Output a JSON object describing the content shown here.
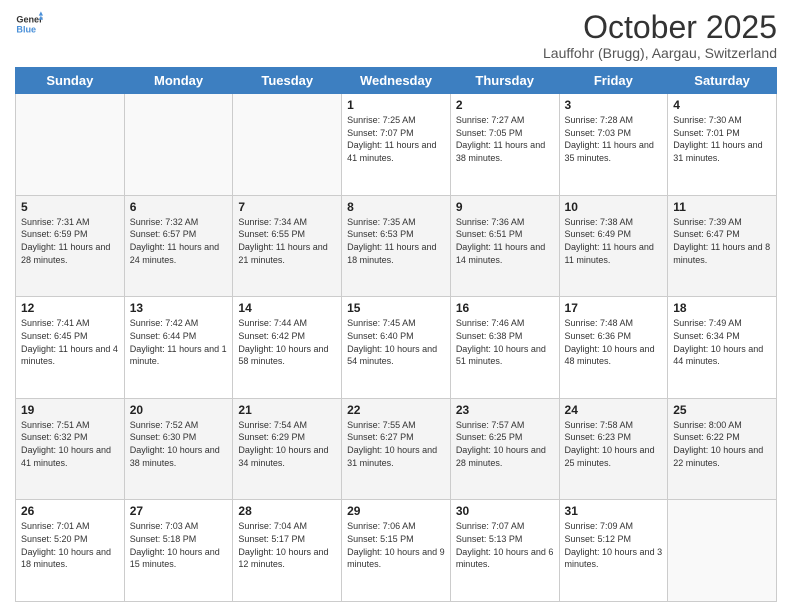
{
  "header": {
    "logo_line1": "General",
    "logo_line2": "Blue",
    "month_title": "October 2025",
    "location": "Lauffohr (Brugg), Aargau, Switzerland"
  },
  "weekdays": [
    "Sunday",
    "Monday",
    "Tuesday",
    "Wednesday",
    "Thursday",
    "Friday",
    "Saturday"
  ],
  "weeks": [
    [
      {
        "day": "",
        "info": ""
      },
      {
        "day": "",
        "info": ""
      },
      {
        "day": "",
        "info": ""
      },
      {
        "day": "1",
        "info": "Sunrise: 7:25 AM\nSunset: 7:07 PM\nDaylight: 11 hours and 41 minutes."
      },
      {
        "day": "2",
        "info": "Sunrise: 7:27 AM\nSunset: 7:05 PM\nDaylight: 11 hours and 38 minutes."
      },
      {
        "day": "3",
        "info": "Sunrise: 7:28 AM\nSunset: 7:03 PM\nDaylight: 11 hours and 35 minutes."
      },
      {
        "day": "4",
        "info": "Sunrise: 7:30 AM\nSunset: 7:01 PM\nDaylight: 11 hours and 31 minutes."
      }
    ],
    [
      {
        "day": "5",
        "info": "Sunrise: 7:31 AM\nSunset: 6:59 PM\nDaylight: 11 hours and 28 minutes."
      },
      {
        "day": "6",
        "info": "Sunrise: 7:32 AM\nSunset: 6:57 PM\nDaylight: 11 hours and 24 minutes."
      },
      {
        "day": "7",
        "info": "Sunrise: 7:34 AM\nSunset: 6:55 PM\nDaylight: 11 hours and 21 minutes."
      },
      {
        "day": "8",
        "info": "Sunrise: 7:35 AM\nSunset: 6:53 PM\nDaylight: 11 hours and 18 minutes."
      },
      {
        "day": "9",
        "info": "Sunrise: 7:36 AM\nSunset: 6:51 PM\nDaylight: 11 hours and 14 minutes."
      },
      {
        "day": "10",
        "info": "Sunrise: 7:38 AM\nSunset: 6:49 PM\nDaylight: 11 hours and 11 minutes."
      },
      {
        "day": "11",
        "info": "Sunrise: 7:39 AM\nSunset: 6:47 PM\nDaylight: 11 hours and 8 minutes."
      }
    ],
    [
      {
        "day": "12",
        "info": "Sunrise: 7:41 AM\nSunset: 6:45 PM\nDaylight: 11 hours and 4 minutes."
      },
      {
        "day": "13",
        "info": "Sunrise: 7:42 AM\nSunset: 6:44 PM\nDaylight: 11 hours and 1 minute."
      },
      {
        "day": "14",
        "info": "Sunrise: 7:44 AM\nSunset: 6:42 PM\nDaylight: 10 hours and 58 minutes."
      },
      {
        "day": "15",
        "info": "Sunrise: 7:45 AM\nSunset: 6:40 PM\nDaylight: 10 hours and 54 minutes."
      },
      {
        "day": "16",
        "info": "Sunrise: 7:46 AM\nSunset: 6:38 PM\nDaylight: 10 hours and 51 minutes."
      },
      {
        "day": "17",
        "info": "Sunrise: 7:48 AM\nSunset: 6:36 PM\nDaylight: 10 hours and 48 minutes."
      },
      {
        "day": "18",
        "info": "Sunrise: 7:49 AM\nSunset: 6:34 PM\nDaylight: 10 hours and 44 minutes."
      }
    ],
    [
      {
        "day": "19",
        "info": "Sunrise: 7:51 AM\nSunset: 6:32 PM\nDaylight: 10 hours and 41 minutes."
      },
      {
        "day": "20",
        "info": "Sunrise: 7:52 AM\nSunset: 6:30 PM\nDaylight: 10 hours and 38 minutes."
      },
      {
        "day": "21",
        "info": "Sunrise: 7:54 AM\nSunset: 6:29 PM\nDaylight: 10 hours and 34 minutes."
      },
      {
        "day": "22",
        "info": "Sunrise: 7:55 AM\nSunset: 6:27 PM\nDaylight: 10 hours and 31 minutes."
      },
      {
        "day": "23",
        "info": "Sunrise: 7:57 AM\nSunset: 6:25 PM\nDaylight: 10 hours and 28 minutes."
      },
      {
        "day": "24",
        "info": "Sunrise: 7:58 AM\nSunset: 6:23 PM\nDaylight: 10 hours and 25 minutes."
      },
      {
        "day": "25",
        "info": "Sunrise: 8:00 AM\nSunset: 6:22 PM\nDaylight: 10 hours and 22 minutes."
      }
    ],
    [
      {
        "day": "26",
        "info": "Sunrise: 7:01 AM\nSunset: 5:20 PM\nDaylight: 10 hours and 18 minutes."
      },
      {
        "day": "27",
        "info": "Sunrise: 7:03 AM\nSunset: 5:18 PM\nDaylight: 10 hours and 15 minutes."
      },
      {
        "day": "28",
        "info": "Sunrise: 7:04 AM\nSunset: 5:17 PM\nDaylight: 10 hours and 12 minutes."
      },
      {
        "day": "29",
        "info": "Sunrise: 7:06 AM\nSunset: 5:15 PM\nDaylight: 10 hours and 9 minutes."
      },
      {
        "day": "30",
        "info": "Sunrise: 7:07 AM\nSunset: 5:13 PM\nDaylight: 10 hours and 6 minutes."
      },
      {
        "day": "31",
        "info": "Sunrise: 7:09 AM\nSunset: 5:12 PM\nDaylight: 10 hours and 3 minutes."
      },
      {
        "day": "",
        "info": ""
      }
    ]
  ]
}
